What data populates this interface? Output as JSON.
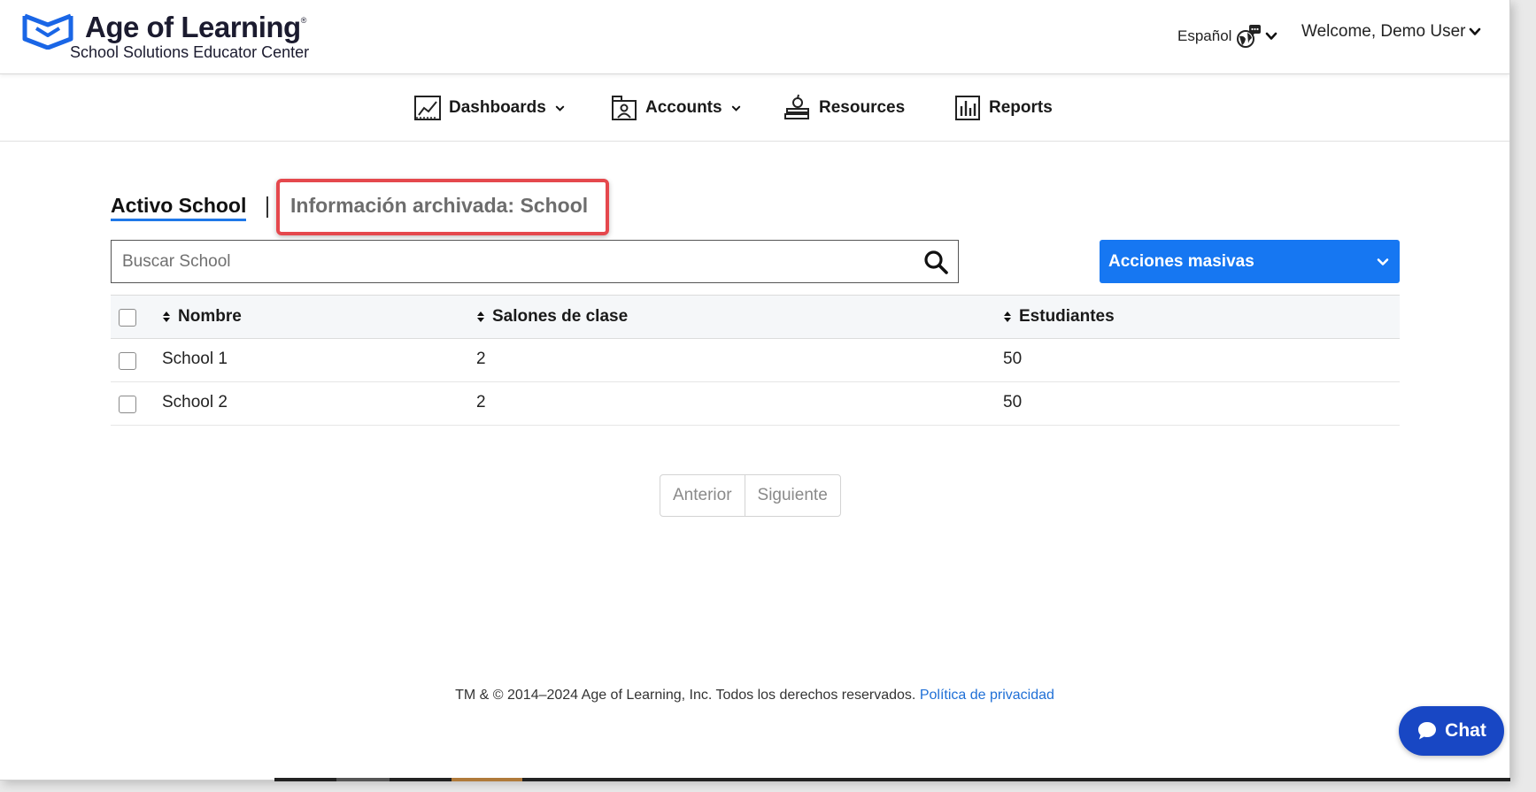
{
  "brand": {
    "title": "Age of Learning",
    "registered": "®",
    "subtitle": "School Solutions Educator Center"
  },
  "header": {
    "language_label": "Español",
    "welcome": "Welcome, Demo User"
  },
  "nav": {
    "dashboards": "Dashboards",
    "accounts": "Accounts",
    "resources": "Resources",
    "reports": "Reports"
  },
  "tabs": {
    "active": "Activo School",
    "archived": "Información archivada: School"
  },
  "search": {
    "placeholder": "Buscar School",
    "value": ""
  },
  "bulk_actions": {
    "label": "Acciones masivas"
  },
  "table": {
    "columns": [
      "Nombre",
      "Salones de clase",
      "Estudiantes"
    ],
    "rows": [
      {
        "name": "School 1",
        "classrooms": "2",
        "students": "50"
      },
      {
        "name": "School 2",
        "classrooms": "2",
        "students": "50"
      }
    ]
  },
  "pagination": {
    "prev": "Anterior",
    "next": "Siguiente"
  },
  "footer": {
    "copyright": "TM & © 2014–2024 Age of Learning, Inc. Todos los derechos reservados.",
    "privacy_link": "Política de privacidad"
  },
  "chat": {
    "label": "Chat"
  },
  "colors": {
    "primary_blue": "#1677f2",
    "chat_blue": "#1847c4",
    "highlight_red": "#e5484d",
    "brand_navy": "#1b1b2f"
  }
}
